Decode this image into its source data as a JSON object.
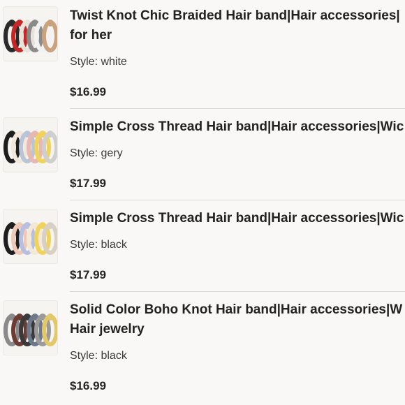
{
  "items": [
    {
      "title_line1": "Twist Knot Chic Braided Hair band|Hair accessories|",
      "title_line2": "for her",
      "style": "Style: white",
      "price": "$16.99",
      "thumb_icon": "hair-bands-knot-image",
      "colors": [
        "#2b2b2b",
        "#c62828",
        "#e8e2d8",
        "#8a8a8a",
        "#f2f2f2",
        "#c9a27e"
      ]
    },
    {
      "title_line1": "Simple Cross Thread Hair band|Hair accessories|Wic",
      "style": "Style: gery",
      "price": "$17.99",
      "thumb_icon": "hair-bands-cross-image",
      "colors": [
        "#1e1e1e",
        "#f3e7dc",
        "#b9c4d6",
        "#e8b7b0",
        "#f0d35a",
        "#cfcfcf"
      ]
    },
    {
      "title_line1": "Simple Cross Thread Hair band|Hair accessories|Wic",
      "style": "Style: black",
      "price": "$17.99",
      "thumb_icon": "hair-bands-cross-image",
      "colors": [
        "#1e1e1e",
        "#efc9b8",
        "#b6bfe0",
        "#f3e8d6",
        "#f0d35a",
        "#d9d0c4"
      ]
    },
    {
      "title_line1": "Solid Color Boho Knot Hair band|Hair accessories|W",
      "title_line2": "Hair jewelry",
      "style": "Style: black",
      "price": "$16.99",
      "thumb_icon": "hair-bands-boho-image",
      "colors": [
        "#8a8a8a",
        "#6b3b34",
        "#3a3a3a",
        "#6d7a8c",
        "#9a9a9a",
        "#e3c86a"
      ]
    }
  ]
}
